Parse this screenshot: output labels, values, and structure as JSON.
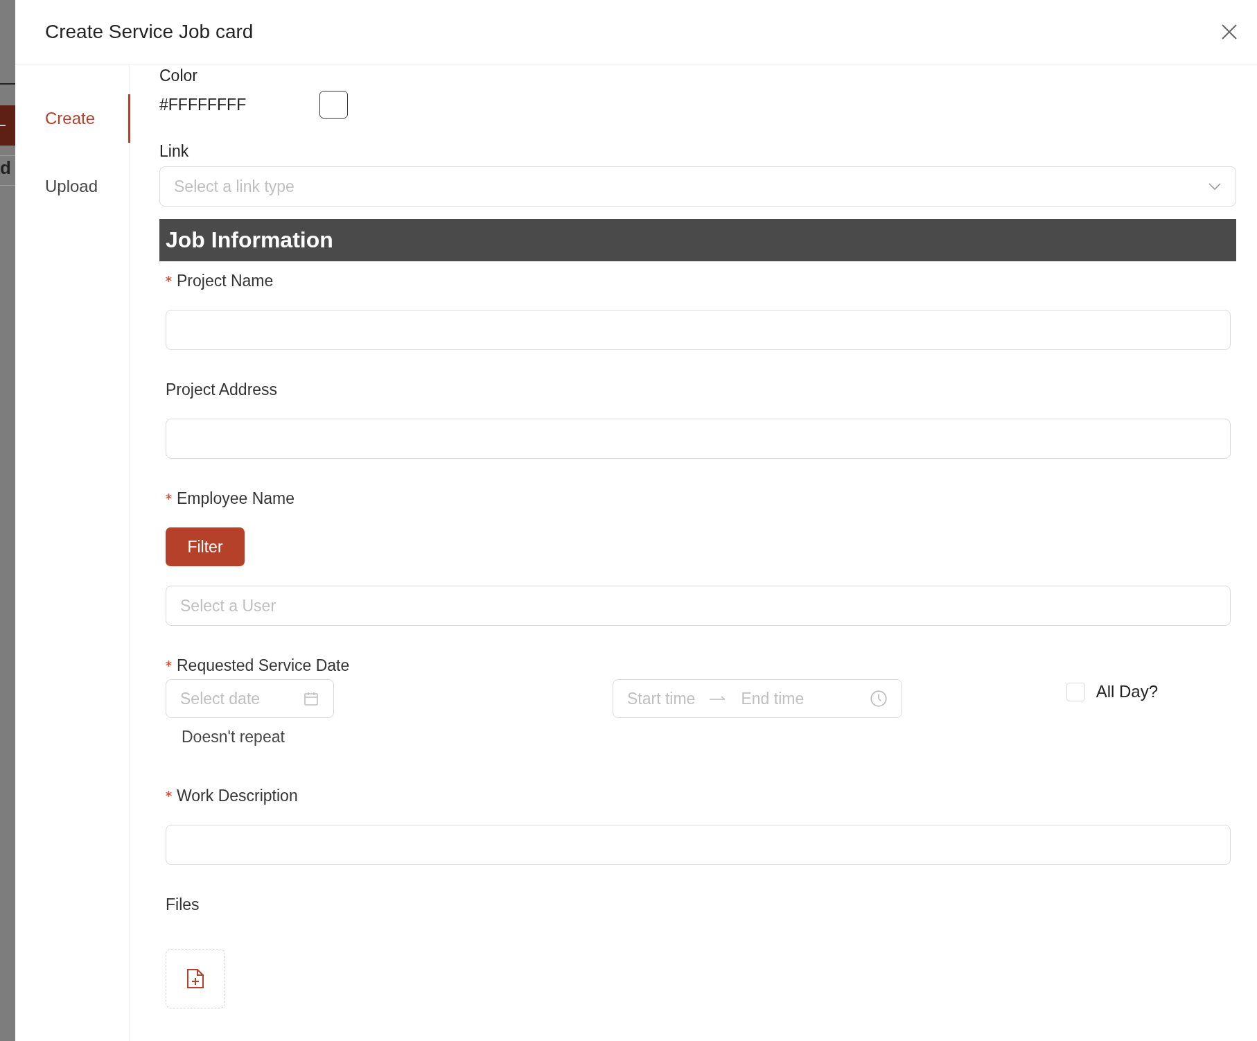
{
  "backdrop": {
    "text": "d"
  },
  "dialog": {
    "title": "Create Service Job card"
  },
  "side_tabs": [
    {
      "label": "Create",
      "selected": true
    },
    {
      "label": "Upload",
      "selected": false
    }
  ],
  "color_field": {
    "label": "Color",
    "value": "#FFFFFFFF"
  },
  "link_field": {
    "label": "Link",
    "placeholder": "Select a link type"
  },
  "section": {
    "title": "Job Information"
  },
  "fields": [
    {
      "kind": "input",
      "label": "Project Name",
      "required": true
    },
    {
      "kind": "input",
      "label": "Project Address",
      "required": false
    },
    {
      "kind": "user",
      "label": "Employee Name",
      "required": true,
      "button": "Filter",
      "placeholder": "Select a User"
    },
    {
      "kind": "datetime",
      "label": "Requested Service Date",
      "required": true,
      "date_placeholder": "Select date",
      "start_placeholder": "Start time",
      "end_placeholder": "End time",
      "all_day": {
        "label": "All Day?",
        "checked": false
      },
      "repeat": "Doesn't repeat"
    },
    {
      "kind": "input",
      "label": "Work Description",
      "required": true
    },
    {
      "kind": "files",
      "label": "Files",
      "required": false
    }
  ]
}
